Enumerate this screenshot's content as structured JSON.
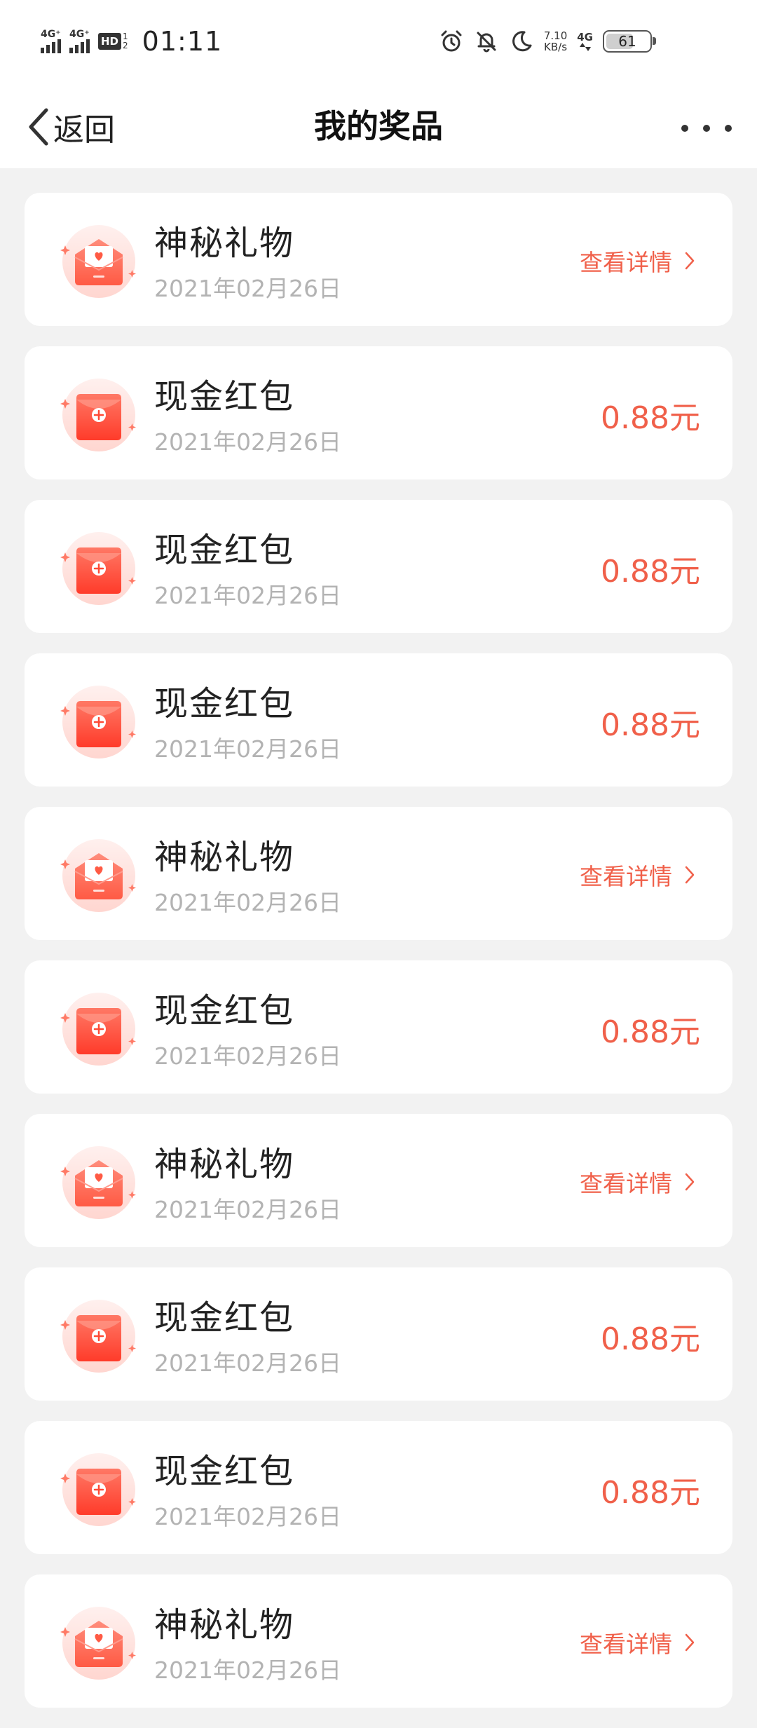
{
  "status_bar": {
    "sim1": "4G⁺",
    "sim2": "4G⁺",
    "hd_label": "HD",
    "hd_sub1": "1",
    "hd_sub2": "2",
    "time": "01:11",
    "net_speed_value": "7.10",
    "net_speed_unit": "KB/s",
    "net_type": "4G",
    "battery_level": "61",
    "icons": [
      "alarm-icon",
      "bell-off-icon",
      "moon-icon"
    ]
  },
  "nav": {
    "back_label": "返回",
    "title": "我的奖品"
  },
  "colors": {
    "accent": "#f0604a",
    "background": "#f2f2f2",
    "card": "#ffffff",
    "date_text": "#b3b3b3"
  },
  "prizes": [
    {
      "type": "gift",
      "name": "神秘礼物",
      "date": "2021年02月26日",
      "action": "查看详情"
    },
    {
      "type": "cash",
      "name": "现金红包",
      "date": "2021年02月26日",
      "amount": "0.88元"
    },
    {
      "type": "cash",
      "name": "现金红包",
      "date": "2021年02月26日",
      "amount": "0.88元"
    },
    {
      "type": "cash",
      "name": "现金红包",
      "date": "2021年02月26日",
      "amount": "0.88元"
    },
    {
      "type": "gift",
      "name": "神秘礼物",
      "date": "2021年02月26日",
      "action": "查看详情"
    },
    {
      "type": "cash",
      "name": "现金红包",
      "date": "2021年02月26日",
      "amount": "0.88元"
    },
    {
      "type": "gift",
      "name": "神秘礼物",
      "date": "2021年02月26日",
      "action": "查看详情"
    },
    {
      "type": "cash",
      "name": "现金红包",
      "date": "2021年02月26日",
      "amount": "0.88元"
    },
    {
      "type": "cash",
      "name": "现金红包",
      "date": "2021年02月26日",
      "amount": "0.88元"
    },
    {
      "type": "gift",
      "name": "神秘礼物",
      "date": "2021年02月26日",
      "action": "查看详情"
    }
  ]
}
